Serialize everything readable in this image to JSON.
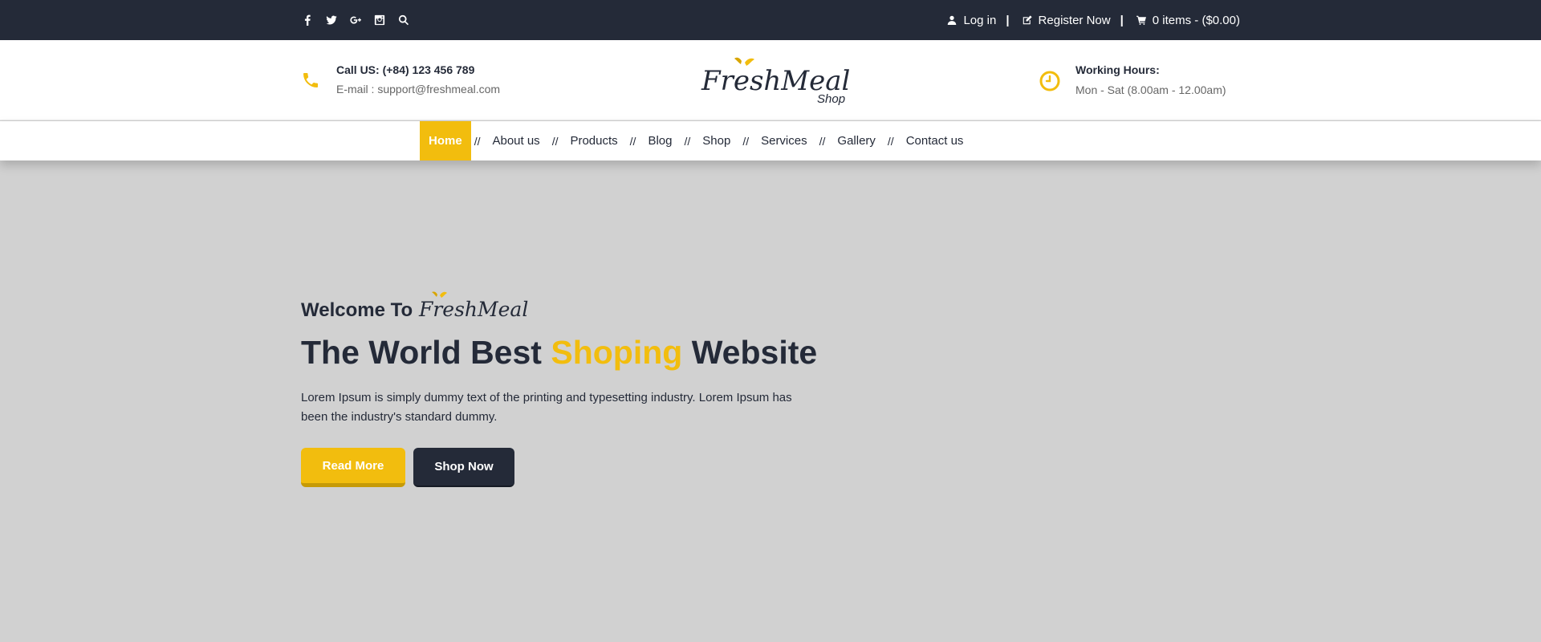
{
  "topbar": {
    "social_icons": [
      "facebook-icon",
      "twitter-icon",
      "google-plus-icon",
      "instagram-icon",
      "search-icon"
    ],
    "login_label": "Log in",
    "separator": "|",
    "register_label": "Register Now",
    "cart_label": "0 items - ($0.00)"
  },
  "header": {
    "contact_line1": "Call US: (+84) 123 456 789",
    "contact_line2": "E-mail : support@freshmeal.com",
    "logo_text": "FreshMeal",
    "logo_sub": "Shop",
    "hours_title": "Working Hours:",
    "hours_value": "Mon - Sat (8.00am - 12.00am)"
  },
  "nav": {
    "items": [
      "Home",
      "About us",
      "Products",
      "Blog",
      "Shop",
      "Services",
      "Gallery",
      "Contact us"
    ],
    "divider": "//",
    "active": "Home"
  },
  "hero": {
    "welcome": "Welcome To",
    "welcome_logo": "FreshMeal",
    "headline_pre": "The World Best",
    "headline_highlight": "Shoping",
    "headline_post": "Website",
    "description": "Lorem Ipsum is simply dummy text of the printing and typesetting industry. Lorem Ipsum has been the industry's standard dummy.",
    "read_more": "Read More",
    "shop_now": "Shop Now"
  },
  "colors": {
    "accent": "#f2bd0e",
    "dark": "#242a38",
    "hero_bg": "#d1d1d1"
  }
}
